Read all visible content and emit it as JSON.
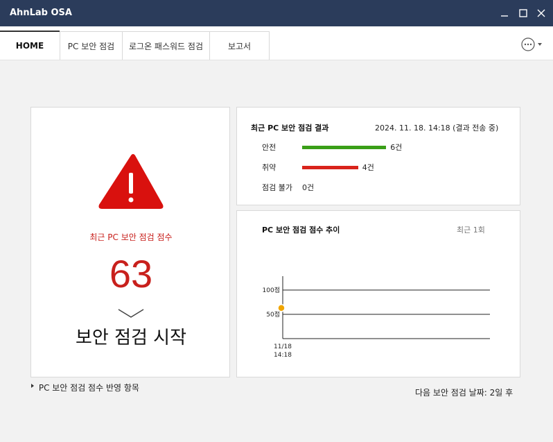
{
  "app": {
    "title": "AhnLab OSA"
  },
  "window": {
    "min_icon": "minimize-icon",
    "max_icon": "maximize-icon",
    "close_icon": "close-icon"
  },
  "tabs": [
    {
      "label": "HOME",
      "active": true
    },
    {
      "label": "PC 보안 점검",
      "active": false
    },
    {
      "label": "로그온 패스워드 점검",
      "active": false
    },
    {
      "label": "보고서",
      "active": false
    }
  ],
  "more_icon": "more-options-icon",
  "score_panel": {
    "icon": "warning-triangle-icon",
    "label": "최근 PC 보안 점검 점수",
    "score": "63",
    "start_label": "보안 점검 시작"
  },
  "results": {
    "title": "최근 PC 보안 점검 결과",
    "date": "2024. 11. 18. 14:18 (결과 전송 중)",
    "rows": [
      {
        "label": "안전",
        "value": "6건",
        "count": 6,
        "color": "#3a9f18"
      },
      {
        "label": "취약",
        "value": "4건",
        "count": 4,
        "color": "#d9241c"
      },
      {
        "label": "점검 불가",
        "value": "0건",
        "count": 0,
        "color": "#888888"
      }
    ]
  },
  "trend": {
    "title": "PC 보안 점검 점수 추이",
    "range": "최근 1회"
  },
  "chart_data": {
    "type": "line",
    "title": "PC 보안 점검 점수 추이",
    "y_ticks": [
      "100점",
      "50점"
    ],
    "ylim": [
      0,
      100
    ],
    "x": [
      "11/18 14:18"
    ],
    "series": [
      {
        "values": [
          63
        ]
      }
    ],
    "point_color": "#f0a500"
  },
  "footer": {
    "link": "PC 보안 점검 점수 반영 항목",
    "next": "다음 보안 점검 날짜: 2일 후"
  }
}
